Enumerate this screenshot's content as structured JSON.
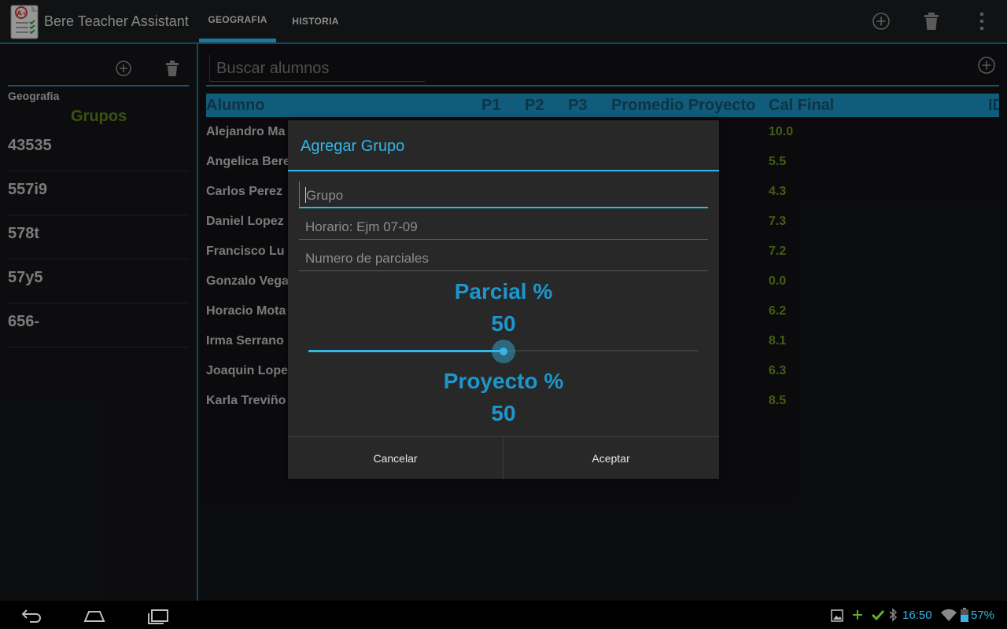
{
  "app": {
    "title": "Bere Teacher Assistant",
    "tabs": [
      {
        "label": "GEOGRAFIA",
        "selected": true
      },
      {
        "label": "HISTORIA",
        "selected": false
      }
    ]
  },
  "sidebar": {
    "subject": "Geografia",
    "groups_title": "Grupos",
    "groups": [
      "43535",
      "557i9",
      "578t",
      "57y5",
      "656-"
    ]
  },
  "main": {
    "search_placeholder": "Buscar alumnos",
    "columns": [
      "Alumno",
      "P1",
      "P2",
      "P3",
      "Promedio Proyecto",
      "Cal Final",
      "ID"
    ],
    "rows": [
      {
        "name": "Alejandro Ma",
        "cal": "10.0"
      },
      {
        "name": "Angelica Bere",
        "cal": "5.5"
      },
      {
        "name": "Carlos Perez",
        "cal": "4.3"
      },
      {
        "name": "Daniel Lopez",
        "cal": "7.3"
      },
      {
        "name": "Francisco Lu",
        "cal": "7.2"
      },
      {
        "name": "Gonzalo Vega",
        "cal": "0.0"
      },
      {
        "name": "Horacio Mota",
        "cal": "6.2"
      },
      {
        "name": "Irma Serrano",
        "cal": "8.1"
      },
      {
        "name": "Joaquin Lope",
        "cal": "6.3"
      },
      {
        "name": "Karla Treviño",
        "cal": "8.5"
      }
    ]
  },
  "dialog": {
    "title": "Agregar Grupo",
    "fields": [
      {
        "value": "",
        "placeholder": "Grupo"
      },
      {
        "value": "",
        "placeholder": "Horario: Ejm 07-09"
      },
      {
        "value": "",
        "placeholder": "Numero de parciales"
      }
    ],
    "parcial_label": "Parcial %",
    "parcial_value": "50",
    "slider_fraction": 0.5,
    "proyecto_label": "Proyecto %",
    "proyecto_value": "50",
    "cancel_label": "Cancelar",
    "accept_label": "Aceptar"
  },
  "status": {
    "time": "16:50",
    "battery": "57%"
  },
  "colors": {
    "accent": "#33b5e5",
    "header_bg": "#1b8cbd",
    "grade_green": "#6b8f1e",
    "groups_green": "#5a7f1c"
  },
  "icons": {
    "actionbar": [
      "add-circle-icon",
      "trash-icon",
      "overflow-menu-icon"
    ],
    "nav": [
      "back-icon",
      "home-icon",
      "recent-apps-icon"
    ],
    "status": [
      "image-icon",
      "plus-icon",
      "check-icon",
      "bluetooth-icon",
      "wifi-icon",
      "battery-icon"
    ]
  }
}
